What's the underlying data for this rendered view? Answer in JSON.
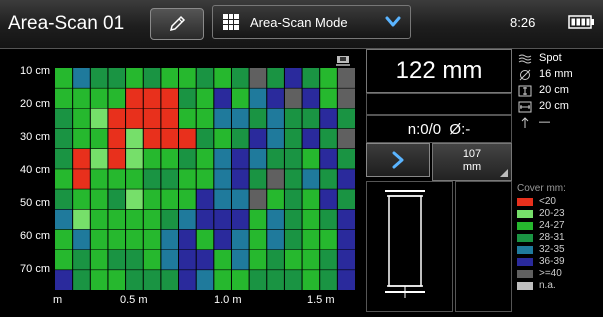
{
  "header": {
    "title": "Area-Scan 01",
    "mode_label": "Area-Scan Mode",
    "time": "8:26"
  },
  "chart": {
    "y_labels": [
      "10 cm",
      "20 cm",
      "30 cm",
      "40 cm",
      "50 cm",
      "60 cm",
      "70 cm"
    ],
    "x_labels": [
      "m",
      "0.5 m",
      "1.0 m",
      "1.5 m"
    ]
  },
  "readout": {
    "value": "122 mm",
    "count": "n:0/0  Ø:-",
    "depth_value": "107",
    "depth_unit": "mm"
  },
  "info": {
    "mode": "Spot",
    "diameter": "16 mm",
    "spacing_v": "20 cm",
    "spacing_h": "20 cm",
    "direction": "—"
  },
  "legend": {
    "title": "Cover mm:",
    "items": [
      {
        "label": "<20",
        "color": "#e8301c"
      },
      {
        "label": "20-23",
        "color": "#76df6a"
      },
      {
        "label": "24-27",
        "color": "#26b82e"
      },
      {
        "label": "28-31",
        "color": "#1a9443"
      },
      {
        "label": "32-35",
        "color": "#1f7a9c"
      },
      {
        "label": "36-39",
        "color": "#2a2a9c"
      },
      {
        "label": ">=40",
        "color": "#606060"
      },
      {
        "label": "n.a.",
        "color": "#bfbfbf"
      }
    ]
  },
  "heatmap": {
    "colors": {
      "R": "#e8301c",
      "L": "#76df6a",
      "M": "#26b82e",
      "D": "#1a9443",
      "T": "#1f7a9c",
      "B": "#2a2a9c",
      "G": "#606060",
      "W": "#bfbfbf"
    },
    "rows": [
      "MTDDMDMMDMDGDBDMG",
      "MMMMRRRDMBMTBGBMG",
      "DMLRRRRMMTTDTDDBD",
      "DMMRLRRRDMDBTDBDG",
      "DRLRLMMDMTBTDDMBD",
      "MRMMMDDMMTBDGDTDB",
      "DMMDLMMMBTTGMDMBD",
      "TLMMMMDTBBBMTDMDB",
      "MTMMMMTBMBTMTDMMB",
      "MDMDDMTBBMTMDMMDB",
      "BDMMDDDBTMMDDDMDB"
    ]
  }
}
